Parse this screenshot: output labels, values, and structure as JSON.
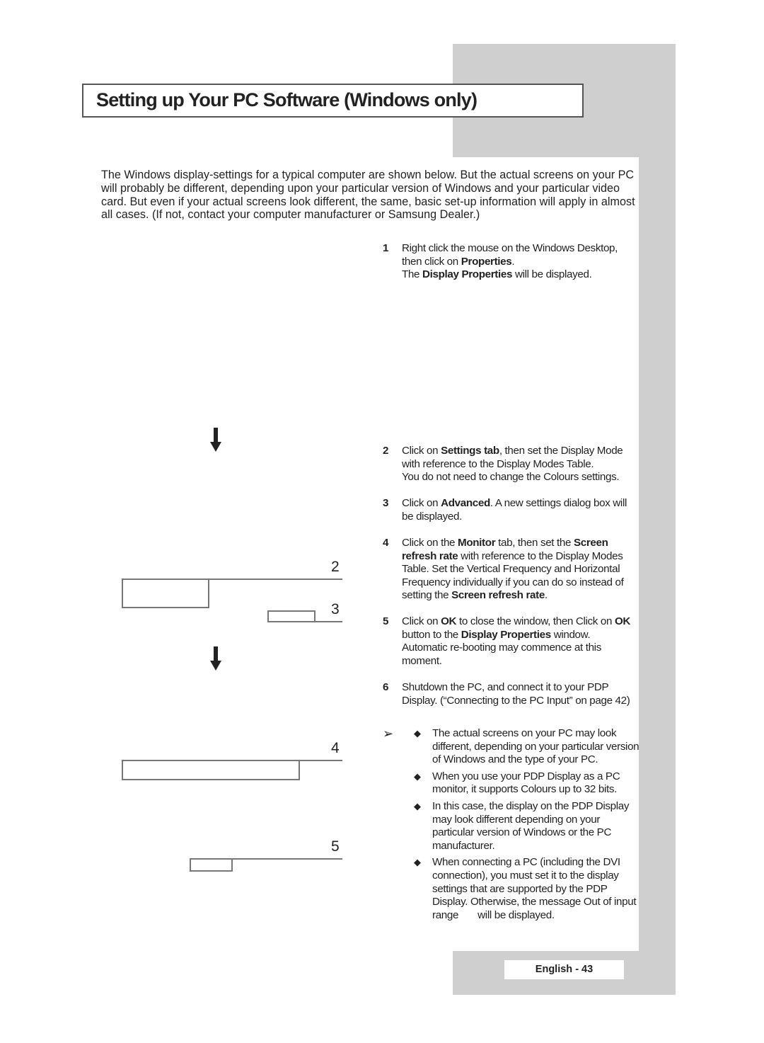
{
  "title": "Setting up Your PC Software (Windows only)",
  "intro": "The Windows display-settings for a typical computer are shown below. But the actual screens on your PC will probably be different, depending upon your particular version of Windows and your particular video card. But even if your actual screens look different, the same, basic set-up information will apply in almost all cases. (If not, contact your computer manufacturer or Samsung Dealer.)",
  "steps": [
    {
      "num": "1",
      "parts": [
        "Right click the mouse on the Windows Desktop, then click on ",
        "Properties",
        ".",
        "The ",
        "Display Properties",
        " will be displayed."
      ]
    },
    {
      "num": "2",
      "parts": [
        "Click on ",
        "Settings tab",
        ", then set the Display Mode with reference to the Display Modes Table.",
        "You do not need to change the Colours settings."
      ]
    },
    {
      "num": "3",
      "parts": [
        "Click on ",
        "Advanced",
        ". A new settings dialog box will be displayed."
      ]
    },
    {
      "num": "4",
      "parts": [
        "Click on the ",
        "Monitor",
        " tab, then set the ",
        "Screen refresh rate",
        " with reference to the Display Modes Table. Set the Vertical Frequency and Horizontal Frequency individually if you can do so instead of setting the ",
        "Screen refresh rate",
        "."
      ]
    },
    {
      "num": "5",
      "parts": [
        "Click on ",
        "OK",
        " to close the window, then Click on ",
        "OK",
        " button to the ",
        "Display Properties",
        " window. Automatic re-booting may commence at this moment."
      ]
    },
    {
      "num": "6",
      "parts": [
        "Shutdown the PC, and connect it to your PDP Display. (“Connecting to the PC Input” on page 42)"
      ]
    }
  ],
  "notes_icon": "note-arrow-icon",
  "notes": [
    "The actual screens on your PC may look different, depending on your particular version of Windows and the type of your PC.",
    "When you use your PDP Display as a PC monitor, it supports Colours up to 32 bits.",
    "In this case, the display on the PDP Display may look different depending on your particular version of Windows or the PC manufacturer.",
    "When connecting a PC (including the DVI connection), you must set it to the display settings that are supported by the PDP Display. Otherwise, the message Out of input range       will be displayed."
  ],
  "callouts": [
    "2",
    "3",
    "4",
    "5"
  ],
  "footer": "English - 43",
  "colors": {
    "band": "#cfcfcf",
    "text": "#222222",
    "frame": "#555555"
  }
}
